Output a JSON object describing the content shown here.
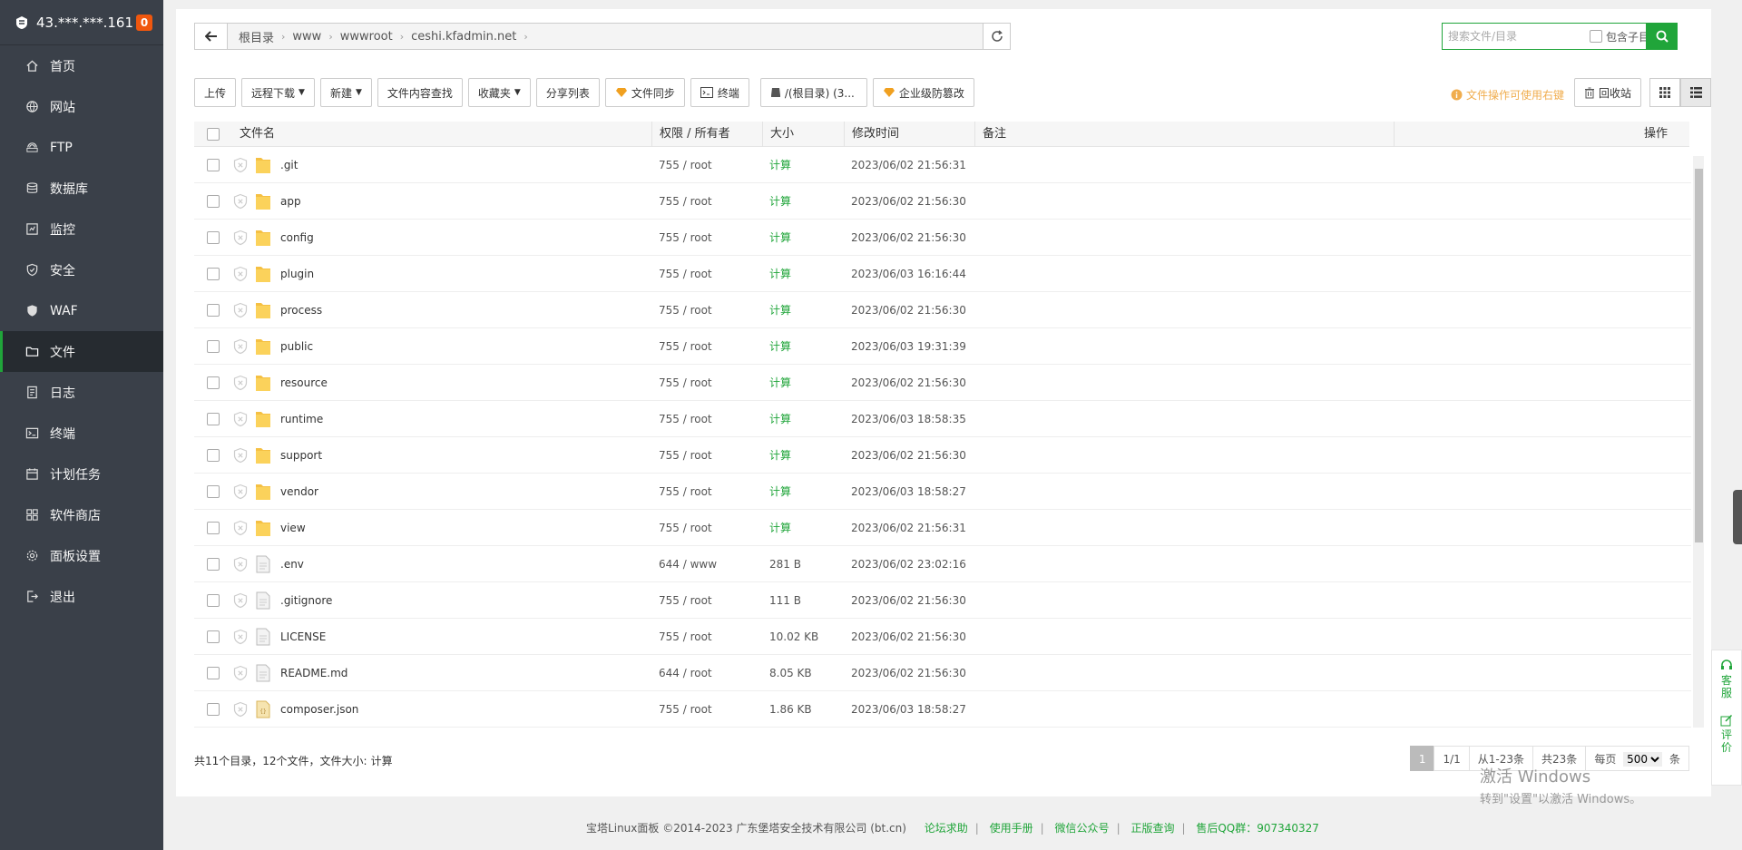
{
  "sidebar": {
    "server_ip": "43.***.***.161",
    "badge_count": "0",
    "items": [
      {
        "label": "首页",
        "icon": "home-icon"
      },
      {
        "label": "网站",
        "icon": "globe-icon"
      },
      {
        "label": "FTP",
        "icon": "ftp-icon"
      },
      {
        "label": "数据库",
        "icon": "database-icon"
      },
      {
        "label": "监控",
        "icon": "monitor-icon"
      },
      {
        "label": "安全",
        "icon": "shield-check-icon"
      },
      {
        "label": "WAF",
        "icon": "waf-shield-icon"
      },
      {
        "label": "文件",
        "icon": "folder-icon",
        "active": true
      },
      {
        "label": "日志",
        "icon": "log-icon"
      },
      {
        "label": "终端",
        "icon": "terminal-icon"
      },
      {
        "label": "计划任务",
        "icon": "calendar-icon"
      },
      {
        "label": "软件商店",
        "icon": "apps-icon"
      },
      {
        "label": "面板设置",
        "icon": "settings-icon"
      },
      {
        "label": "退出",
        "icon": "logout-icon"
      }
    ]
  },
  "breadcrumb": [
    "根目录",
    "www",
    "wwwroot",
    "ceshi.kfadmin.net"
  ],
  "search": {
    "placeholder": "搜索文件/目录",
    "include_sub_label": "包含子目录"
  },
  "toolbar": {
    "upload": "上传",
    "remote_download": "远程下载",
    "new": "新建",
    "content_search": "文件内容查找",
    "favorites": "收藏夹",
    "share_list": "分享列表",
    "file_sync": "文件同步",
    "terminal": "终端",
    "disk": "/(根目录) (3...",
    "tamper_protect": "企业级防篡改",
    "right_click_tip": "文件操作可使用右键",
    "recycle_bin": "回收站"
  },
  "table": {
    "headers": {
      "name": "文件名",
      "perm": "权限 / 所有者",
      "size": "大小",
      "mtime": "修改时间",
      "note": "备注",
      "ops": "操作"
    },
    "rows": [
      {
        "name": ".git",
        "type": "folder",
        "perm": "755 / root",
        "size": "计算",
        "mtime": "2023/06/02 21:56:31"
      },
      {
        "name": "app",
        "type": "folder",
        "perm": "755 / root",
        "size": "计算",
        "mtime": "2023/06/02 21:56:30"
      },
      {
        "name": "config",
        "type": "folder",
        "perm": "755 / root",
        "size": "计算",
        "mtime": "2023/06/02 21:56:30"
      },
      {
        "name": "plugin",
        "type": "folder",
        "perm": "755 / root",
        "size": "计算",
        "mtime": "2023/06/03 16:16:44"
      },
      {
        "name": "process",
        "type": "folder",
        "perm": "755 / root",
        "size": "计算",
        "mtime": "2023/06/02 21:56:30"
      },
      {
        "name": "public",
        "type": "folder",
        "perm": "755 / root",
        "size": "计算",
        "mtime": "2023/06/03 19:31:39"
      },
      {
        "name": "resource",
        "type": "folder",
        "perm": "755 / root",
        "size": "计算",
        "mtime": "2023/06/02 21:56:30"
      },
      {
        "name": "runtime",
        "type": "folder",
        "perm": "755 / root",
        "size": "计算",
        "mtime": "2023/06/03 18:58:35"
      },
      {
        "name": "support",
        "type": "folder",
        "perm": "755 / root",
        "size": "计算",
        "mtime": "2023/06/02 21:56:30"
      },
      {
        "name": "vendor",
        "type": "folder",
        "perm": "755 / root",
        "size": "计算",
        "mtime": "2023/06/03 18:58:27"
      },
      {
        "name": "view",
        "type": "folder",
        "perm": "755 / root",
        "size": "计算",
        "mtime": "2023/06/02 21:56:31"
      },
      {
        "name": ".env",
        "type": "file",
        "perm": "644 / www",
        "size": "281 B",
        "mtime": "2023/06/02 23:02:16"
      },
      {
        "name": ".gitignore",
        "type": "file",
        "perm": "755 / root",
        "size": "111 B",
        "mtime": "2023/06/02 21:56:30"
      },
      {
        "name": "LICENSE",
        "type": "file",
        "perm": "755 / root",
        "size": "10.02 KB",
        "mtime": "2023/06/02 21:56:30"
      },
      {
        "name": "README.md",
        "type": "file",
        "perm": "644 / root",
        "size": "8.05 KB",
        "mtime": "2023/06/02 21:56:30"
      },
      {
        "name": "composer.json",
        "type": "json",
        "perm": "755 / root",
        "size": "1.86 KB",
        "mtime": "2023/06/03 18:58:27"
      }
    ]
  },
  "summary": {
    "text": "共11个目录，12个文件，文件大小:",
    "calc": "计算"
  },
  "pager": {
    "current": "1",
    "pages": "1/1",
    "range": "从1-23条",
    "total": "共23条",
    "per_page_label": "每页",
    "per_page": "500",
    "unit": "条"
  },
  "float": {
    "service": "客服",
    "review": "评价"
  },
  "watermark": {
    "line1": "激活 Windows",
    "line2": "转到\"设置\"以激活 Windows。"
  },
  "footer": {
    "copyright": "宝塔Linux面板 ©2014-2023 广东堡塔安全技术有限公司 (bt.cn)",
    "links": [
      "论坛求助",
      "使用手册",
      "微信公众号",
      "正版查询"
    ],
    "qq": "售后QQ群：907340327"
  },
  "colors": {
    "accent": "#20a53a",
    "sidebar_bg": "#3a4049",
    "badge": "#f0570e",
    "tip": "#f0ad4e"
  }
}
